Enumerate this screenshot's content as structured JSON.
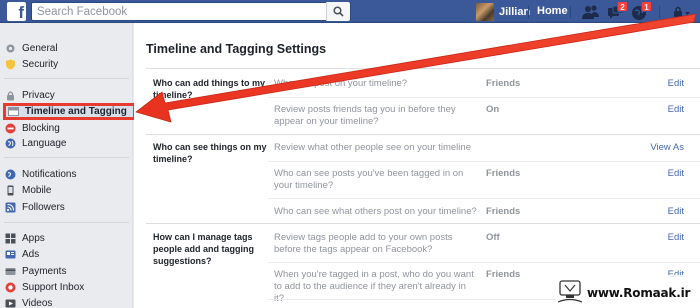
{
  "topbar": {
    "search_placeholder": "Search Facebook",
    "user_name": "Jillian",
    "home_label": "Home",
    "friend_requests_icon": "friends-icon",
    "messages_badge": "2",
    "notifications_badge": "1"
  },
  "sidebar": {
    "groups": [
      {
        "items": [
          {
            "label": "General",
            "icon": "gear-icon"
          },
          {
            "label": "Security",
            "icon": "shield-icon"
          }
        ]
      },
      {
        "items": [
          {
            "label": "Privacy",
            "icon": "lock-icon"
          },
          {
            "label": "Timeline and Tagging",
            "icon": "timeline-icon",
            "active": true
          },
          {
            "label": "Blocking",
            "icon": "block-icon"
          },
          {
            "label": "Language",
            "icon": "globe-icon"
          }
        ]
      },
      {
        "items": [
          {
            "label": "Notifications",
            "icon": "globe-notif-icon"
          },
          {
            "label": "Mobile",
            "icon": "mobile-icon"
          },
          {
            "label": "Followers",
            "icon": "rss-icon"
          }
        ]
      },
      {
        "items": [
          {
            "label": "Apps",
            "icon": "apps-icon"
          },
          {
            "label": "Ads",
            "icon": "ads-icon"
          },
          {
            "label": "Payments",
            "icon": "payments-icon"
          },
          {
            "label": "Support Inbox",
            "icon": "support-icon"
          },
          {
            "label": "Videos",
            "icon": "video-icon"
          }
        ]
      }
    ]
  },
  "main": {
    "title": "Timeline and Tagging Settings",
    "sections": [
      {
        "label": "Who can add things to my timeline?",
        "rows": [
          {
            "question": "Who can post on your timeline?",
            "value": "Friends",
            "action": "Edit"
          },
          {
            "question": "Review posts friends tag you in before they appear on your timeline?",
            "value": "On",
            "action": "Edit"
          }
        ]
      },
      {
        "label": "Who can see things on my timeline?",
        "rows": [
          {
            "question": "Review what other people see on your timeline",
            "value": "",
            "action": "View As"
          },
          {
            "question": "Who can see posts you've been tagged in on your timeline?",
            "value": "Friends",
            "action": "Edit"
          },
          {
            "question": "Who can see what others post on your timeline?",
            "value": "Friends",
            "action": "Edit"
          }
        ]
      },
      {
        "label": "How can I manage tags people add and tagging suggestions?",
        "rows": [
          {
            "question": "Review tags people add to your own posts before the tags appear on Facebook?",
            "value": "Off",
            "action": "Edit"
          },
          {
            "question": "When you're tagged in a post, who do you want to add to the audience if they aren't already in it?",
            "value": "Friends",
            "action": "Edit"
          }
        ]
      }
    ]
  },
  "watermark": {
    "text": "www.Romaak.ir"
  },
  "colors": {
    "brand": "#3b5998",
    "highlight": "#e63b2e",
    "link": "#4267b2"
  }
}
